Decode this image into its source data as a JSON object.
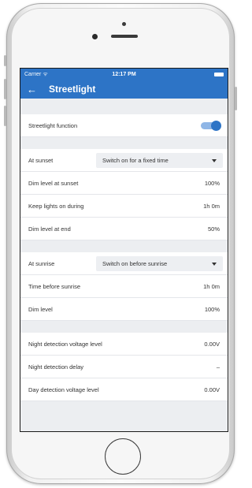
{
  "status": {
    "carrier": "Carrier ᯤ",
    "time": "12:17 PM"
  },
  "nav": {
    "back_icon": "back-arrow-icon",
    "title": "Streetlight"
  },
  "function_row": {
    "label": "Streetlight function",
    "toggle_on": true
  },
  "sunset": {
    "at_label": "At sunset",
    "mode_selected": "Switch on for a fixed time",
    "rows": [
      {
        "label": "Dim level at sunset",
        "value": "100%"
      },
      {
        "label": "Keep lights on during",
        "value": "1h 0m"
      },
      {
        "label": "Dim level at end",
        "value": "50%"
      }
    ]
  },
  "sunrise": {
    "at_label": "At sunrise",
    "mode_selected": "Switch on before sunrise",
    "rows": [
      {
        "label": "Time before sunrise",
        "value": "1h 0m"
      },
      {
        "label": "Dim level",
        "value": "100%"
      }
    ]
  },
  "detection": {
    "rows": [
      {
        "label": "Night detection voltage level",
        "value": "0.00V"
      },
      {
        "label": "Night detection delay",
        "value": "–"
      },
      {
        "label": "Day detection voltage level",
        "value": "0.00V"
      }
    ]
  },
  "colors": {
    "accent": "#2d74c6",
    "background": "#eceef1"
  }
}
